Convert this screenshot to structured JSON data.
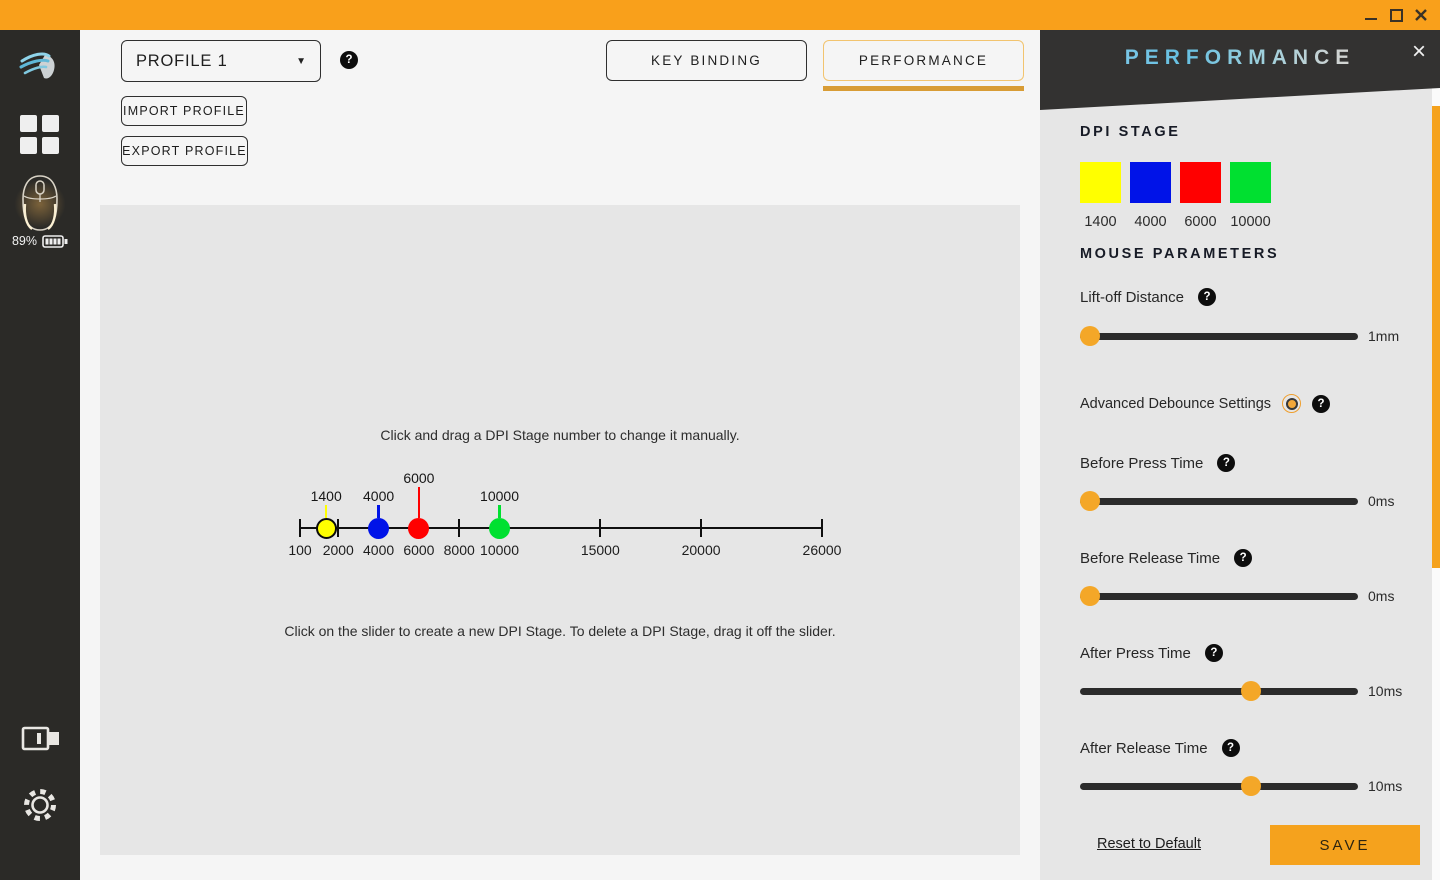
{
  "icons": {
    "help": "?",
    "caret": "▼",
    "close": "×"
  },
  "sidebar": {
    "battery_percent": "89%"
  },
  "toolbar": {
    "profile_value": "PROFILE 1",
    "import_label": "IMPORT PROFILE",
    "export_label": "EXPORT PROFILE"
  },
  "tabs": {
    "key_binding": "KEY BINDING",
    "performance": "PERFORMANCE",
    "active": "PERFORMANCE"
  },
  "dpi_editor": {
    "instruction_top": "Click and drag a DPI Stage number to change it manually.",
    "instruction_bottom": "Click on the slider to create a new DPI Stage. To delete a DPI Stage, drag it off the slider.",
    "axis": {
      "min": 100,
      "max": 26000,
      "ticks": [
        100,
        2000,
        4000,
        6000,
        8000,
        10000,
        15000,
        20000,
        26000
      ]
    },
    "stages": [
      {
        "dpi": 1400,
        "color": "#ffff00",
        "outlined": true,
        "raised": false
      },
      {
        "dpi": 4000,
        "color": "#0013e8",
        "outlined": false,
        "raised": false
      },
      {
        "dpi": 6000,
        "color": "#ff0000",
        "outlined": false,
        "raised": true
      },
      {
        "dpi": 10000,
        "color": "#00e030",
        "outlined": false,
        "raised": false
      }
    ]
  },
  "performance_panel": {
    "title": "PERFORMANCE",
    "dpi_stage_heading": "DPI STAGE",
    "mouse_params_heading": "MOUSE PARAMETERS",
    "liftoff": {
      "label": "Lift-off Distance",
      "value": "1mm",
      "percent": 3.6
    },
    "debounce": {
      "label": "Advanced Debounce Settings",
      "enabled": true
    },
    "sliders": [
      {
        "label": "Before Press Time",
        "value": "0ms",
        "percent": 3.6
      },
      {
        "label": "Before Release Time",
        "value": "0ms",
        "percent": 3.6
      },
      {
        "label": "After Press Time",
        "value": "10ms",
        "percent": 61.5
      },
      {
        "label": "After Release Time",
        "value": "10ms",
        "percent": 61.5
      }
    ],
    "reset_label": "Reset to Default",
    "save_label": "SAVE"
  },
  "colors": {
    "accent_orange": "#f9a01b",
    "save_orange": "#f5a21d",
    "tab_underline": "#d89c35",
    "panel_header_dark": "#333231",
    "sidebar_dark": "#2b2a27",
    "panel_gray": "#e6e6e6",
    "page_gray": "#f5f5f5"
  }
}
